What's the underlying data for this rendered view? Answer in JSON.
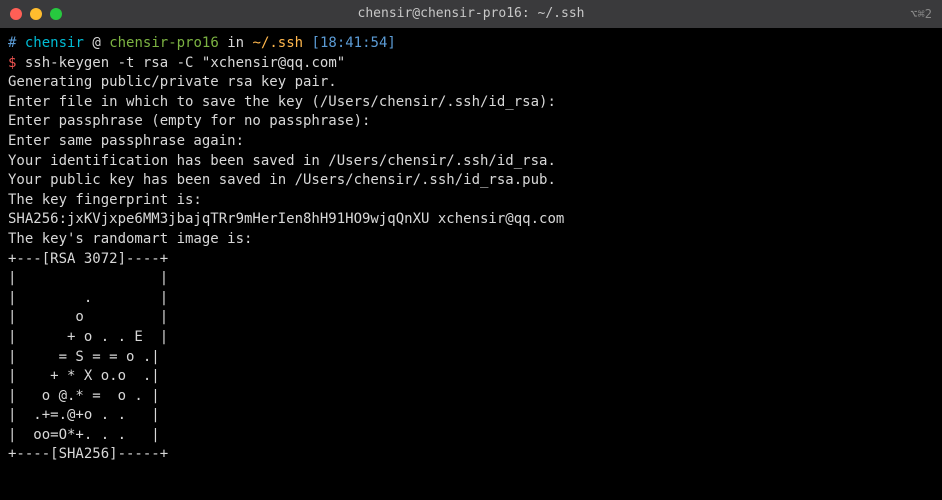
{
  "window": {
    "title": "chensir@chensir-pro16: ~/.ssh",
    "shortcut": "⌥⌘2"
  },
  "prompt": {
    "hash": "#",
    "user": "chensir",
    "at": "@",
    "host": "chensir-pro16",
    "in": "in",
    "path": "~/.ssh",
    "time": "[18:41:54]",
    "dollar": "$"
  },
  "command": {
    "cmd": "ssh-keygen -t rsa -C ",
    "arg": "\"xchensir@qq.com\""
  },
  "output": {
    "l1": "Generating public/private rsa key pair.",
    "l2": "Enter file in which to save the key (/Users/chensir/.ssh/id_rsa):",
    "l3": "Enter passphrase (empty for no passphrase):",
    "l4": "Enter same passphrase again:",
    "l5": "Your identification has been saved in /Users/chensir/.ssh/id_rsa.",
    "l6": "Your public key has been saved in /Users/chensir/.ssh/id_rsa.pub.",
    "l7": "The key fingerprint is:",
    "l8": "SHA256:jxKVjxpe6MM3jbajqTRr9mHerIen8hH91HO9wjqQnXU xchensir@qq.com",
    "l9": "The key's randomart image is:",
    "r1": "+---[RSA 3072]----+",
    "r2": "|                 |",
    "r3": "|        .        |",
    "r4": "|       o         |",
    "r5": "|      + o . . E  |",
    "r6": "|     = S = = o .|",
    "r7": "|    + * X o.o  .|",
    "r8": "|   o @.* =  o . |",
    "r9": "|  .+=.@+o . .   |",
    "r10": "|  oo=O*+. . .   |",
    "r11": "+----[SHA256]-----+"
  }
}
